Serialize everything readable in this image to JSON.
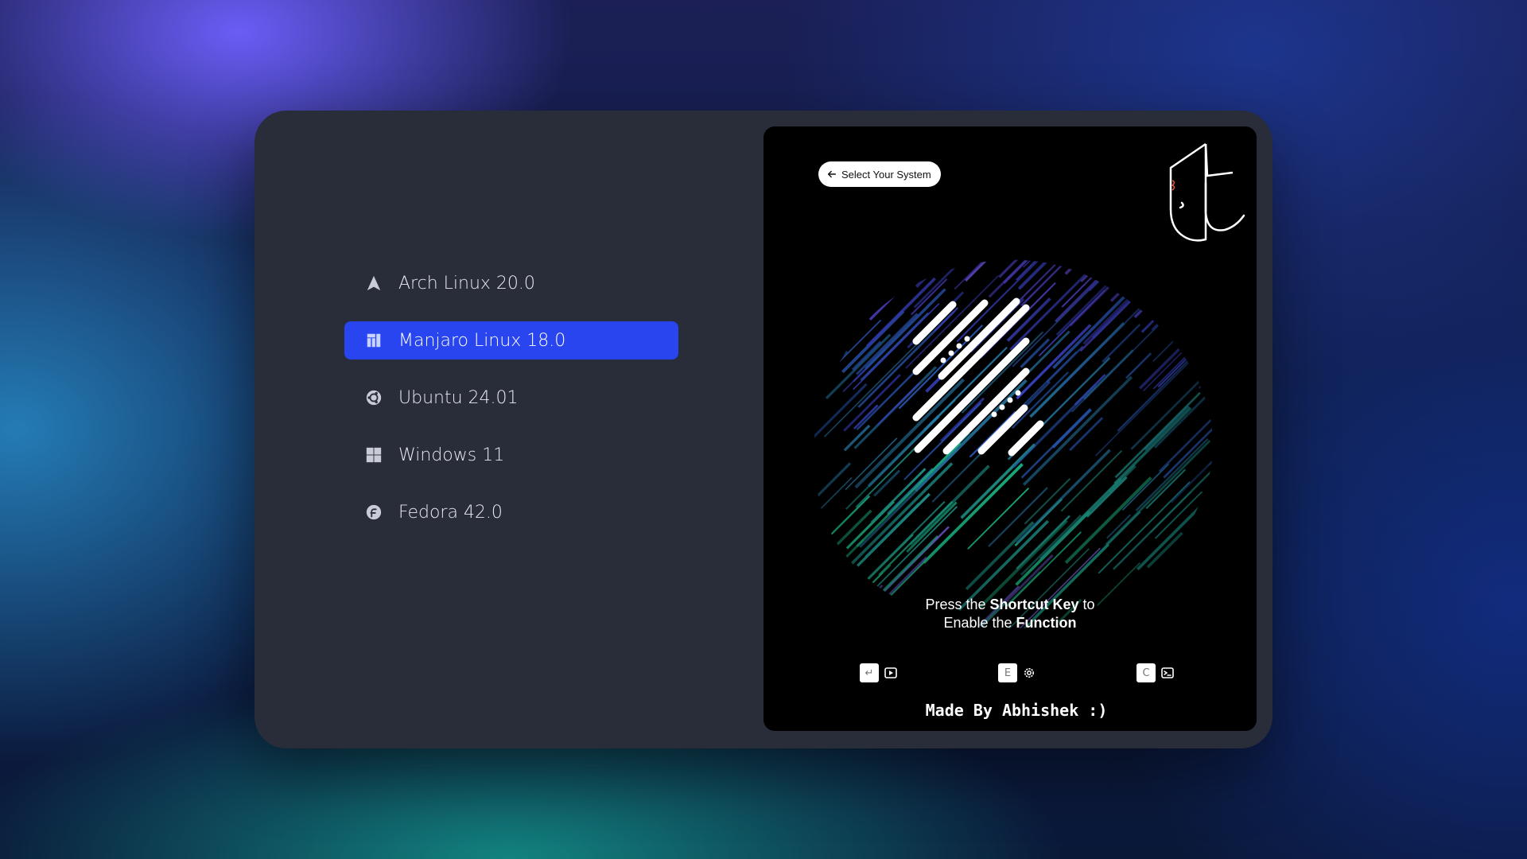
{
  "menu": {
    "items": [
      {
        "label": "Arch Linux 20.0",
        "icon": "arch-icon",
        "selected": false
      },
      {
        "label": "Manjaro Linux 18.0",
        "icon": "manjaro-icon",
        "selected": true
      },
      {
        "label": "Ubuntu 24.01",
        "icon": "ubuntu-icon",
        "selected": false
      },
      {
        "label": "Windows 11",
        "icon": "windows-icon",
        "selected": false
      },
      {
        "label": "Fedora 42.0",
        "icon": "fedora-icon",
        "selected": false
      }
    ]
  },
  "preview": {
    "back_label": "Select Your System",
    "tagline": {
      "line1_a": "Press the ",
      "line1_b": "Shortcut Key",
      "line1_c": " to",
      "line2_a": "Enable the ",
      "line2_b": "Function"
    },
    "shortcuts": [
      {
        "key": "↵",
        "action_icon": "play-icon"
      },
      {
        "key": "E",
        "action_icon": "settings-icon"
      },
      {
        "key": "C",
        "action_icon": "terminal-icon"
      }
    ],
    "credit": "Made By Abhishek :)"
  },
  "colors": {
    "window_bg": "#292d3a",
    "selected_bg": "#2845ef",
    "preview_bg": "#000000"
  }
}
